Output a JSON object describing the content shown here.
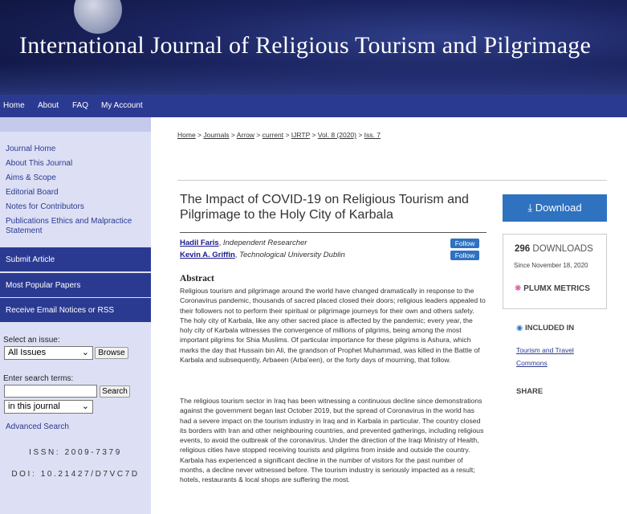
{
  "banner": {
    "title": "International Journal of Religious Tourism and Pilgrimage"
  },
  "nav": {
    "items": [
      "Home",
      "About",
      "FAQ",
      "My Account"
    ]
  },
  "sidebar": {
    "links": [
      "Journal Home",
      "About This Journal",
      "Aims & Scope",
      "Editorial Board",
      "Notes for Contributors",
      "Publications Ethics and Malpractice Statement"
    ],
    "bands": [
      "Submit Article",
      "Most Popular Papers",
      "Receive Email Notices or RSS"
    ],
    "select_issue_label": "Select an issue:",
    "issue_value": "All Issues",
    "browse_label": "Browse",
    "search_label": "Enter search terms:",
    "search_value": "",
    "search_button": "Search",
    "scope_value": "in this journal",
    "advanced_search": "Advanced Search",
    "issn": "ISSN: 2009-7379",
    "doi": "DOI: 10.21427/D7VC7D"
  },
  "breadcrumb": [
    "Home",
    "Journals",
    "Arrow",
    "current",
    "IJRTP",
    "Vol. 8 (2020)",
    "Iss. 7"
  ],
  "article": {
    "title": "The Impact of COVID-19 on Religious Tourism and Pilgrimage to the Holy City of Karbala",
    "authors": [
      {
        "name": "Hadil Faris",
        "affiliation": "Independent Researcher",
        "follow": "Follow"
      },
      {
        "name": "Kevin A. Griffin",
        "affiliation": "Technological University Dublin",
        "follow": "Follow"
      }
    ],
    "abstract_heading": "Abstract",
    "abstract_p1": "Religious tourism and pilgrimage around the world have changed dramatically in response to the Coronavirus pandemic, thousands of sacred placed closed their doors; religious leaders appealed to their followers not to perform their spiritual or pilgrimage journeys for their own and others safety. The holy city of Karbala, like any other sacred place is affected by the pandemic; every year, the holy city of Karbala witnesses the convergence of millions of pilgrims, being among the most important pilgrims for Shia Muslims. Of particular importance for these pilgrims is Ashura, which marks the day that Hussain bin Ali, the grandson of Prophet Muhammad, was killed in the Battle of Karbala and subsequently, Arbaeen (Arba'een), or the forty days of mourning, that follow.",
    "abstract_p2": "The religious tourism sector in Iraq has been witnessing a continuous decline since demonstrations against the government began last October 2019, but the spread of Coronavirus in the world has had a severe impact on the tourism industry in Iraq and in Karbala in particular. The country closed its borders with Iran and other neighbouring countries, and prevented gatherings, including religious events, to avoid the outbreak of the coronavirus. Under the direction of the Iraqi Ministry of Health, religious cities have stopped receiving tourists and pilgrims from inside and outside the country. Karbala has experienced a significant decline in the number of visitors for the past number of months, a decline never witnessed before. The tourism industry is seriously impacted as a result; hotels, restaurants & local shops are suffering the most."
  },
  "right": {
    "download": "Download",
    "downloads_count": "296",
    "downloads_label": "DOWNLOADS",
    "since": "Since November 18, 2020",
    "plumx": "PLUMX METRICS",
    "included_in": "INCLUDED IN",
    "included_link": "Tourism and Travel Commons",
    "share": "SHARE"
  },
  "colors": {
    "nav": "#2b3a91",
    "sidebar": "#dde0f4",
    "accent": "#2f72c0"
  }
}
